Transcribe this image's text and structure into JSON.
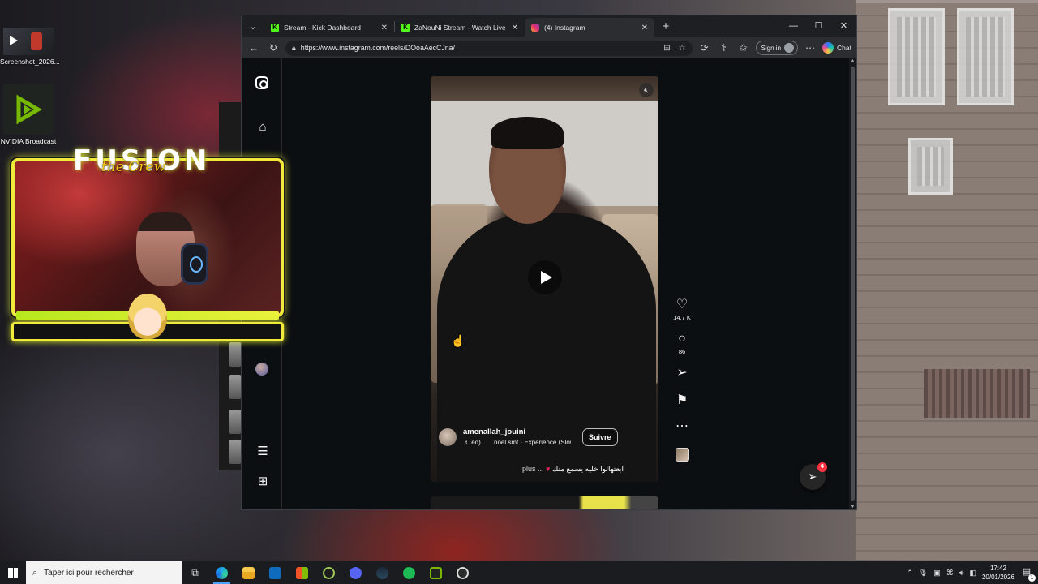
{
  "desktop": {
    "icons": [
      {
        "label": "Screenshot_2026..."
      },
      {
        "label": "NVIDIA Broadcast"
      }
    ]
  },
  "overlay": {
    "logo_text": "FUSION",
    "logo_sub": "the Crew"
  },
  "browser": {
    "tabs": [
      {
        "title": "Stream - Kick Dashboard",
        "favicon": "kick-icon",
        "active": false
      },
      {
        "title": "ZaNouNi Stream - Watch Live on Kick",
        "favicon": "kick-icon",
        "active": false
      },
      {
        "title": "(4) Instagram",
        "favicon": "instagram-icon",
        "active": true
      }
    ],
    "url": "https://www.instagram.com/reels/DOoaAecCJna/",
    "signin_label": "Sign in",
    "chat_label": "Chat"
  },
  "reel": {
    "username": "amenallah_jouini",
    "audio_prefix": "♬ ed)",
    "audio_track": "noel.smt · Experience (Slowed)",
    "follow_label": "Suivre",
    "caption": "ابعتهالوا خليه يسمع منك",
    "caption_more": "plus ...",
    "likes": "14,7 K",
    "comments": "86",
    "messages_badge": "4"
  },
  "taskbar": {
    "search_placeholder": "Taper ici pour rechercher",
    "time": "17:42",
    "date": "20/01/2026",
    "notification_count": "1"
  },
  "colors": {
    "overlay_accent": "#f2ea3a",
    "kick_green": "#53fc18",
    "like_heart": "#e0245e"
  }
}
